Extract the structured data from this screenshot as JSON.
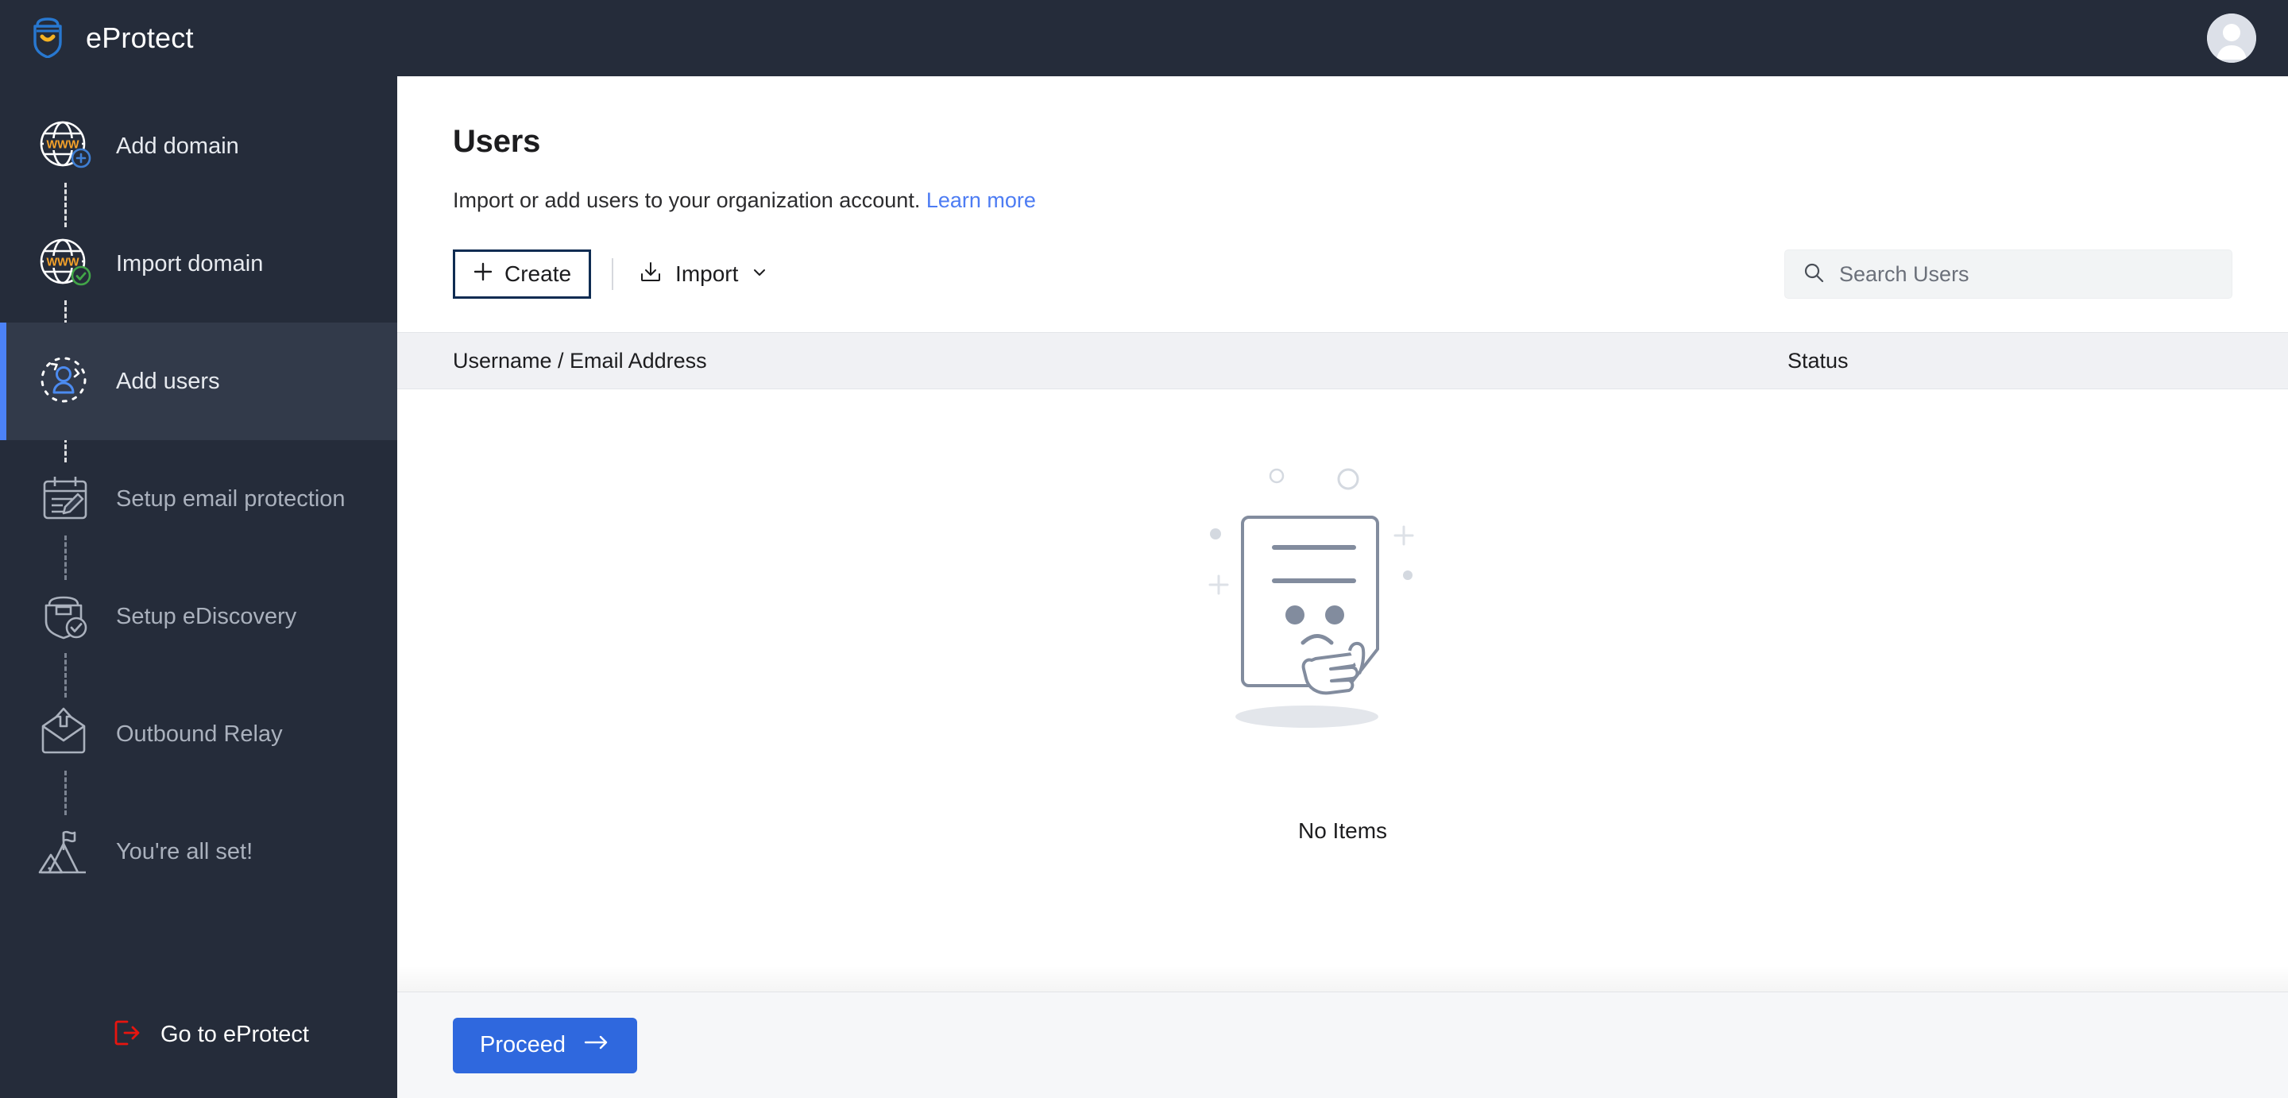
{
  "topbar": {
    "brand_name": "eProtect",
    "logo_icon": "shield-smile-logo",
    "avatar_icon": "user-avatar"
  },
  "sidebar": {
    "items": [
      {
        "label": "Add domain",
        "icon": "globe-www-plus-icon",
        "state": "default",
        "active": false
      },
      {
        "label": "Import domain",
        "icon": "globe-www-check-icon",
        "state": "default",
        "active": false
      },
      {
        "label": "Add users",
        "icon": "add-user-dashed-icon",
        "state": "current",
        "active": true
      },
      {
        "label": "Setup email protection",
        "icon": "calendar-pencil-icon",
        "state": "muted",
        "active": false
      },
      {
        "label": "Setup eDiscovery",
        "icon": "shield-check-icon",
        "state": "muted",
        "active": false
      },
      {
        "label": "Outbound Relay",
        "icon": "envelope-upload-icon",
        "state": "muted",
        "active": false
      },
      {
        "label": "You're all set!",
        "icon": "mountain-flag-icon",
        "state": "muted",
        "active": false
      }
    ],
    "footer": {
      "label": "Go to eProtect",
      "icon": "exit-arrow-icon"
    }
  },
  "main": {
    "title": "Users",
    "subtitle_text": "Import or add users to your organization account.",
    "subtitle_link": "Learn more",
    "toolbar": {
      "create_label": "Create",
      "create_icon": "plus-icon",
      "import_label": "Import",
      "import_icon": "download-box-icon",
      "import_chevron_icon": "chevron-down-icon"
    },
    "search": {
      "placeholder": "Search Users",
      "value": "",
      "icon": "search-icon"
    },
    "table": {
      "columns": [
        "Username / Email Address",
        "Status"
      ],
      "rows": []
    },
    "empty_state": {
      "text": "No Items",
      "illustration": "empty-document-sad-face"
    },
    "footer": {
      "proceed_label": "Proceed",
      "proceed_arrow_icon": "arrow-right-icon"
    }
  },
  "colors": {
    "sidebar_bg": "#252c3a",
    "sidebar_active_bg": "#323a4a",
    "accent_blue": "#4c82f7",
    "primary_button": "#2f68de",
    "link_blue": "#4d7cf3",
    "globe_www_orange": "#f5a22a",
    "check_green": "#42a548",
    "exit_red": "#e8150f",
    "focus_outline": "#0f2c52"
  }
}
